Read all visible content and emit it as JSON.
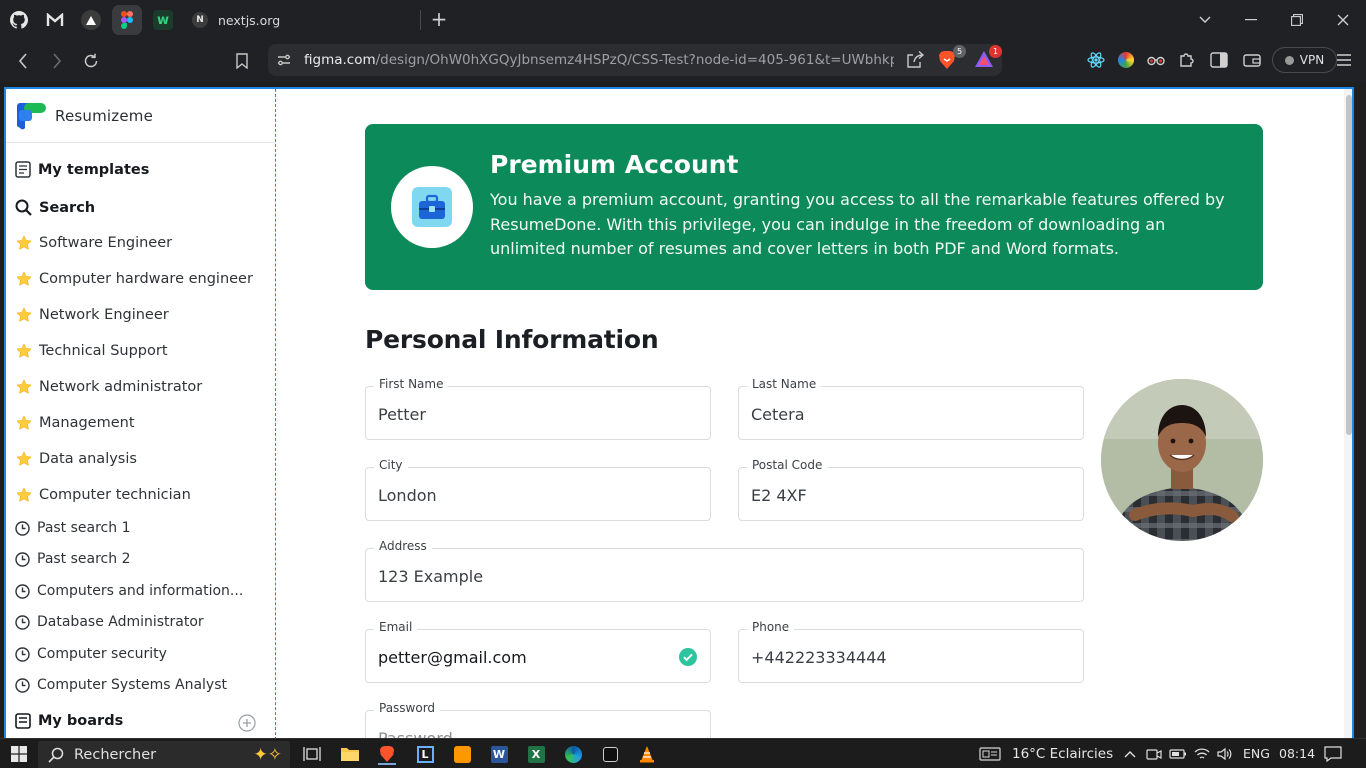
{
  "browser": {
    "active_tab_title": "nextjs.org",
    "active_tab_favicon": "N",
    "url_host": "figma.com",
    "url_path": "/design/OhW0hXGQyJbnsemz4HSPzQ/CSS-Test?node-id=405-961&t=UWbhkpmih...",
    "brave_badge": "5",
    "rewards_badge": "1",
    "vpn_label": "VPN"
  },
  "sidebar": {
    "brand": "Resumizeme",
    "my_templates": "My templates",
    "search": "Search",
    "starred": [
      "Software Engineer",
      "Computer hardware engineer",
      "Network Engineer",
      "Technical Support",
      "Network administrator",
      "Management",
      "Data analysis",
      "Computer technician"
    ],
    "history": [
      "Past search 1",
      "Past search 2",
      "Computers and information...",
      "Database Administrator",
      "Computer security",
      "Computer Systems Analyst"
    ],
    "my_boards": "My boards"
  },
  "banner": {
    "title": "Premium Account",
    "text": "You have a premium account, granting you access to all the remarkable features offered by ResumeDone. With this privilege, you can indulge in the freedom of downloading an unlimited number of resumes and cover letters in both PDF and Word formats."
  },
  "form": {
    "title": "Personal Information",
    "first_name": {
      "label": "First Name",
      "value": "Petter"
    },
    "last_name": {
      "label": "Last Name",
      "value": "Cetera"
    },
    "city": {
      "label": "City",
      "value": "London"
    },
    "postal_code": {
      "label": "Postal Code",
      "value": "E2 4XF"
    },
    "address": {
      "label": "Address",
      "value": "123 Example"
    },
    "email": {
      "label": "Email",
      "value": "petter@gmail.com"
    },
    "phone": {
      "label": "Phone",
      "value": "+442223334444"
    },
    "password": {
      "label": "Password",
      "placeholder": "Password"
    }
  },
  "taskbar": {
    "search_placeholder": "Rechercher",
    "weather": "16°C  Eclaircies",
    "language": "ENG",
    "time": "08:14"
  },
  "colors": {
    "banner_bg": "#0d8a5a",
    "selection_outline": "#1e88e5",
    "success_check": "#2ec4a0"
  }
}
